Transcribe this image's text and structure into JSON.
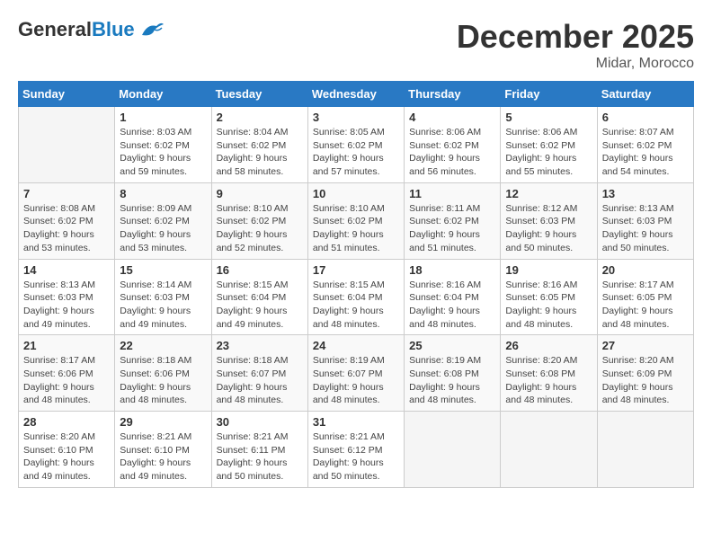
{
  "header": {
    "logo_general": "General",
    "logo_blue": "Blue",
    "month_year": "December 2025",
    "location": "Midar, Morocco"
  },
  "days_of_week": [
    "Sunday",
    "Monday",
    "Tuesday",
    "Wednesday",
    "Thursday",
    "Friday",
    "Saturday"
  ],
  "weeks": [
    [
      {
        "day": "",
        "info": ""
      },
      {
        "day": "1",
        "info": "Sunrise: 8:03 AM\nSunset: 6:02 PM\nDaylight: 9 hours\nand 59 minutes."
      },
      {
        "day": "2",
        "info": "Sunrise: 8:04 AM\nSunset: 6:02 PM\nDaylight: 9 hours\nand 58 minutes."
      },
      {
        "day": "3",
        "info": "Sunrise: 8:05 AM\nSunset: 6:02 PM\nDaylight: 9 hours\nand 57 minutes."
      },
      {
        "day": "4",
        "info": "Sunrise: 8:06 AM\nSunset: 6:02 PM\nDaylight: 9 hours\nand 56 minutes."
      },
      {
        "day": "5",
        "info": "Sunrise: 8:06 AM\nSunset: 6:02 PM\nDaylight: 9 hours\nand 55 minutes."
      },
      {
        "day": "6",
        "info": "Sunrise: 8:07 AM\nSunset: 6:02 PM\nDaylight: 9 hours\nand 54 minutes."
      }
    ],
    [
      {
        "day": "7",
        "info": "Sunrise: 8:08 AM\nSunset: 6:02 PM\nDaylight: 9 hours\nand 53 minutes."
      },
      {
        "day": "8",
        "info": "Sunrise: 8:09 AM\nSunset: 6:02 PM\nDaylight: 9 hours\nand 53 minutes."
      },
      {
        "day": "9",
        "info": "Sunrise: 8:10 AM\nSunset: 6:02 PM\nDaylight: 9 hours\nand 52 minutes."
      },
      {
        "day": "10",
        "info": "Sunrise: 8:10 AM\nSunset: 6:02 PM\nDaylight: 9 hours\nand 51 minutes."
      },
      {
        "day": "11",
        "info": "Sunrise: 8:11 AM\nSunset: 6:02 PM\nDaylight: 9 hours\nand 51 minutes."
      },
      {
        "day": "12",
        "info": "Sunrise: 8:12 AM\nSunset: 6:03 PM\nDaylight: 9 hours\nand 50 minutes."
      },
      {
        "day": "13",
        "info": "Sunrise: 8:13 AM\nSunset: 6:03 PM\nDaylight: 9 hours\nand 50 minutes."
      }
    ],
    [
      {
        "day": "14",
        "info": "Sunrise: 8:13 AM\nSunset: 6:03 PM\nDaylight: 9 hours\nand 49 minutes."
      },
      {
        "day": "15",
        "info": "Sunrise: 8:14 AM\nSunset: 6:03 PM\nDaylight: 9 hours\nand 49 minutes."
      },
      {
        "day": "16",
        "info": "Sunrise: 8:15 AM\nSunset: 6:04 PM\nDaylight: 9 hours\nand 49 minutes."
      },
      {
        "day": "17",
        "info": "Sunrise: 8:15 AM\nSunset: 6:04 PM\nDaylight: 9 hours\nand 48 minutes."
      },
      {
        "day": "18",
        "info": "Sunrise: 8:16 AM\nSunset: 6:04 PM\nDaylight: 9 hours\nand 48 minutes."
      },
      {
        "day": "19",
        "info": "Sunrise: 8:16 AM\nSunset: 6:05 PM\nDaylight: 9 hours\nand 48 minutes."
      },
      {
        "day": "20",
        "info": "Sunrise: 8:17 AM\nSunset: 6:05 PM\nDaylight: 9 hours\nand 48 minutes."
      }
    ],
    [
      {
        "day": "21",
        "info": "Sunrise: 8:17 AM\nSunset: 6:06 PM\nDaylight: 9 hours\nand 48 minutes."
      },
      {
        "day": "22",
        "info": "Sunrise: 8:18 AM\nSunset: 6:06 PM\nDaylight: 9 hours\nand 48 minutes."
      },
      {
        "day": "23",
        "info": "Sunrise: 8:18 AM\nSunset: 6:07 PM\nDaylight: 9 hours\nand 48 minutes."
      },
      {
        "day": "24",
        "info": "Sunrise: 8:19 AM\nSunset: 6:07 PM\nDaylight: 9 hours\nand 48 minutes."
      },
      {
        "day": "25",
        "info": "Sunrise: 8:19 AM\nSunset: 6:08 PM\nDaylight: 9 hours\nand 48 minutes."
      },
      {
        "day": "26",
        "info": "Sunrise: 8:20 AM\nSunset: 6:08 PM\nDaylight: 9 hours\nand 48 minutes."
      },
      {
        "day": "27",
        "info": "Sunrise: 8:20 AM\nSunset: 6:09 PM\nDaylight: 9 hours\nand 48 minutes."
      }
    ],
    [
      {
        "day": "28",
        "info": "Sunrise: 8:20 AM\nSunset: 6:10 PM\nDaylight: 9 hours\nand 49 minutes."
      },
      {
        "day": "29",
        "info": "Sunrise: 8:21 AM\nSunset: 6:10 PM\nDaylight: 9 hours\nand 49 minutes."
      },
      {
        "day": "30",
        "info": "Sunrise: 8:21 AM\nSunset: 6:11 PM\nDaylight: 9 hours\nand 50 minutes."
      },
      {
        "day": "31",
        "info": "Sunrise: 8:21 AM\nSunset: 6:12 PM\nDaylight: 9 hours\nand 50 minutes."
      },
      {
        "day": "",
        "info": ""
      },
      {
        "day": "",
        "info": ""
      },
      {
        "day": "",
        "info": ""
      }
    ]
  ]
}
